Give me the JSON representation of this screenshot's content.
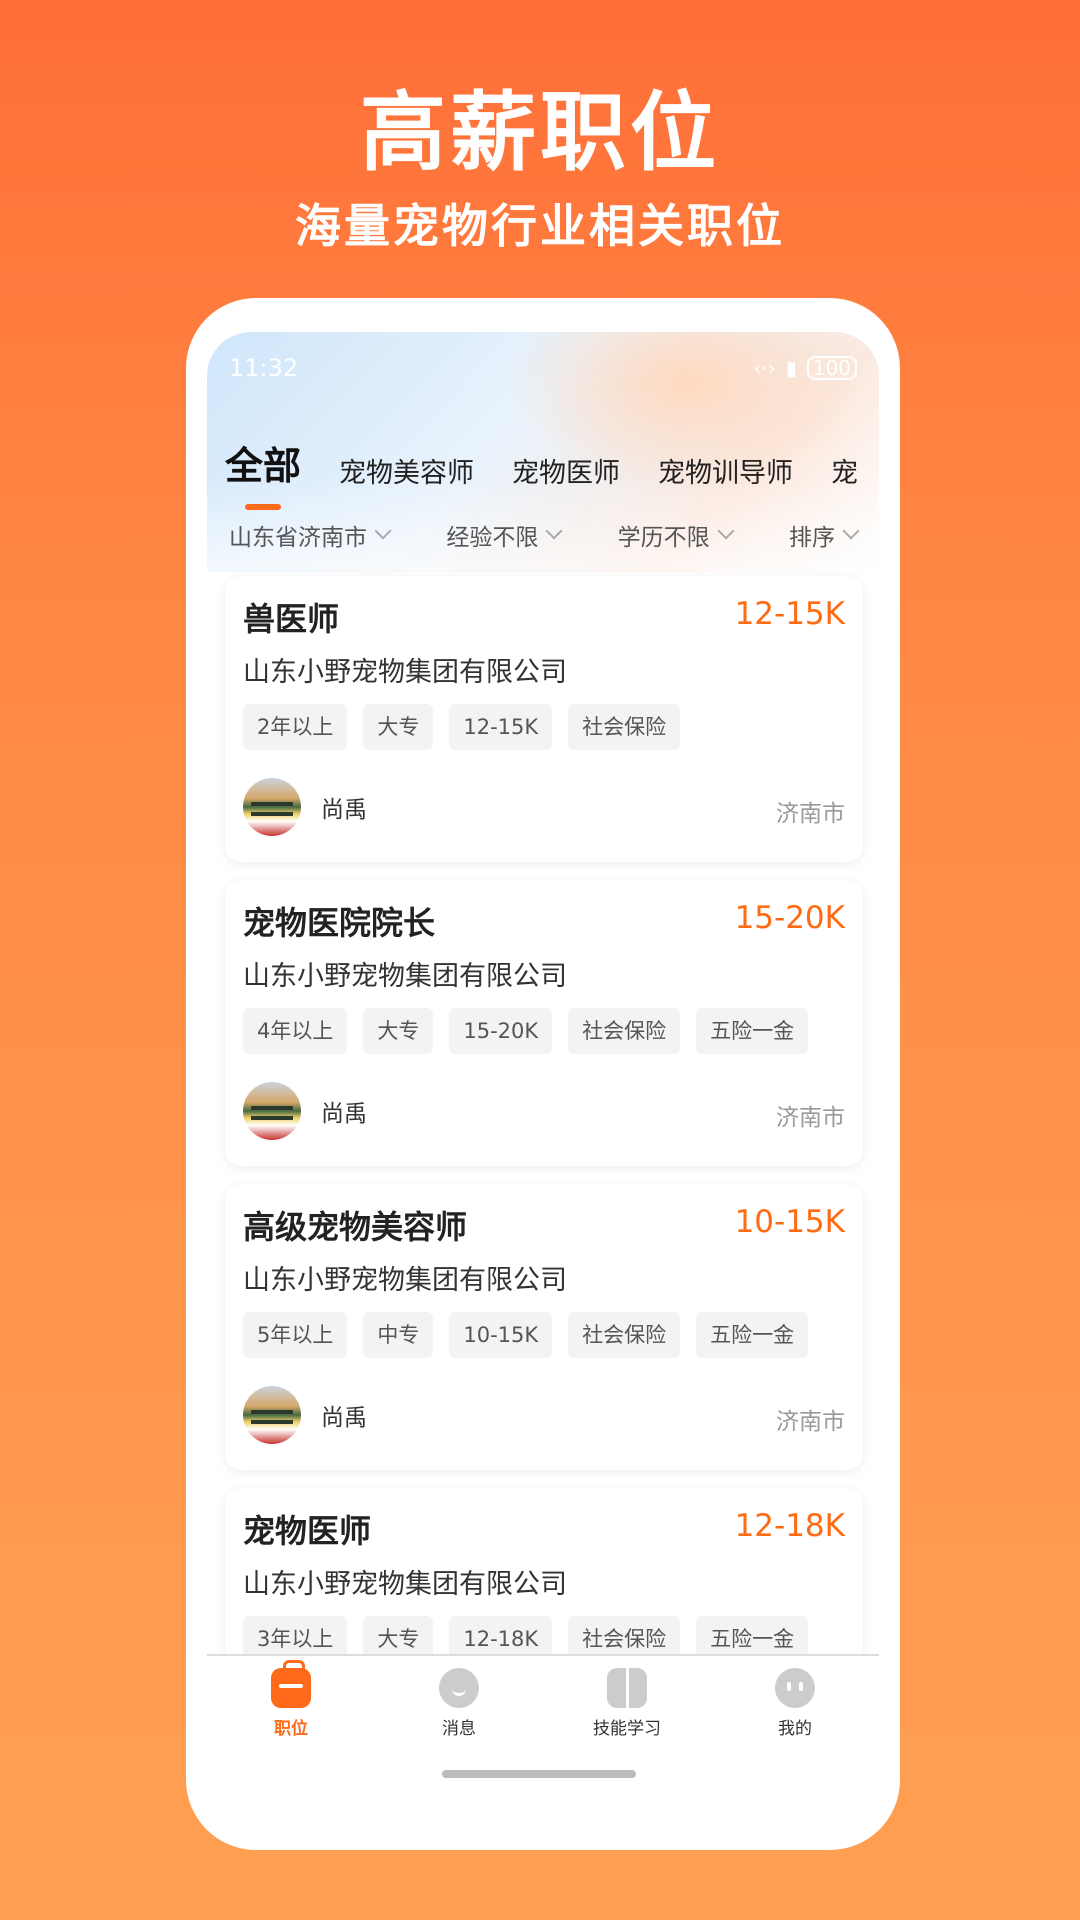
{
  "promo": {
    "title": "高薪职位",
    "subtitle": "海量宠物行业相关职位"
  },
  "status_bar": {
    "time": "11:32",
    "battery": "100"
  },
  "tabs": [
    {
      "label": "全部",
      "active": true
    },
    {
      "label": "宠物美容师"
    },
    {
      "label": "宠物医师"
    },
    {
      "label": "宠物训导师"
    },
    {
      "label": "宠"
    }
  ],
  "filters": [
    {
      "label": "山东省济南市"
    },
    {
      "label": "经验不限"
    },
    {
      "label": "学历不限"
    },
    {
      "label": "排序"
    }
  ],
  "jobs": [
    {
      "title": "兽医师",
      "salary": "12-15K",
      "company": "山东小野宠物集团有限公司",
      "tags": [
        "2年以上",
        "大专",
        "12-15K",
        "社会保险"
      ],
      "recruiter": "尚禹",
      "city": "济南市"
    },
    {
      "title": "宠物医院院长",
      "salary": "15-20K",
      "company": "山东小野宠物集团有限公司",
      "tags": [
        "4年以上",
        "大专",
        "15-20K",
        "社会保险",
        "五险一金"
      ],
      "recruiter": "尚禹",
      "city": "济南市"
    },
    {
      "title": "高级宠物美容师",
      "salary": "10-15K",
      "company": "山东小野宠物集团有限公司",
      "tags": [
        "5年以上",
        "中专",
        "10-15K",
        "社会保险",
        "五险一金"
      ],
      "recruiter": "尚禹",
      "city": "济南市"
    },
    {
      "title": "宠物医师",
      "salary": "12-18K",
      "company": "山东小野宠物集团有限公司",
      "tags": [
        "3年以上",
        "大专",
        "12-18K",
        "社会保险",
        "五险一金"
      ],
      "recruiter": "",
      "city": ""
    }
  ],
  "tabbar": [
    {
      "label": "职位",
      "icon": "briefcase-icon",
      "active": true
    },
    {
      "label": "消息",
      "icon": "message-icon"
    },
    {
      "label": "技能学习",
      "icon": "book-icon"
    },
    {
      "label": "我的",
      "icon": "profile-icon"
    }
  ],
  "colors": {
    "accent": "#ff6a1a",
    "salary": "#ff6a12",
    "background_top": "#ff6f38",
    "background_bottom": "#ffa052"
  }
}
